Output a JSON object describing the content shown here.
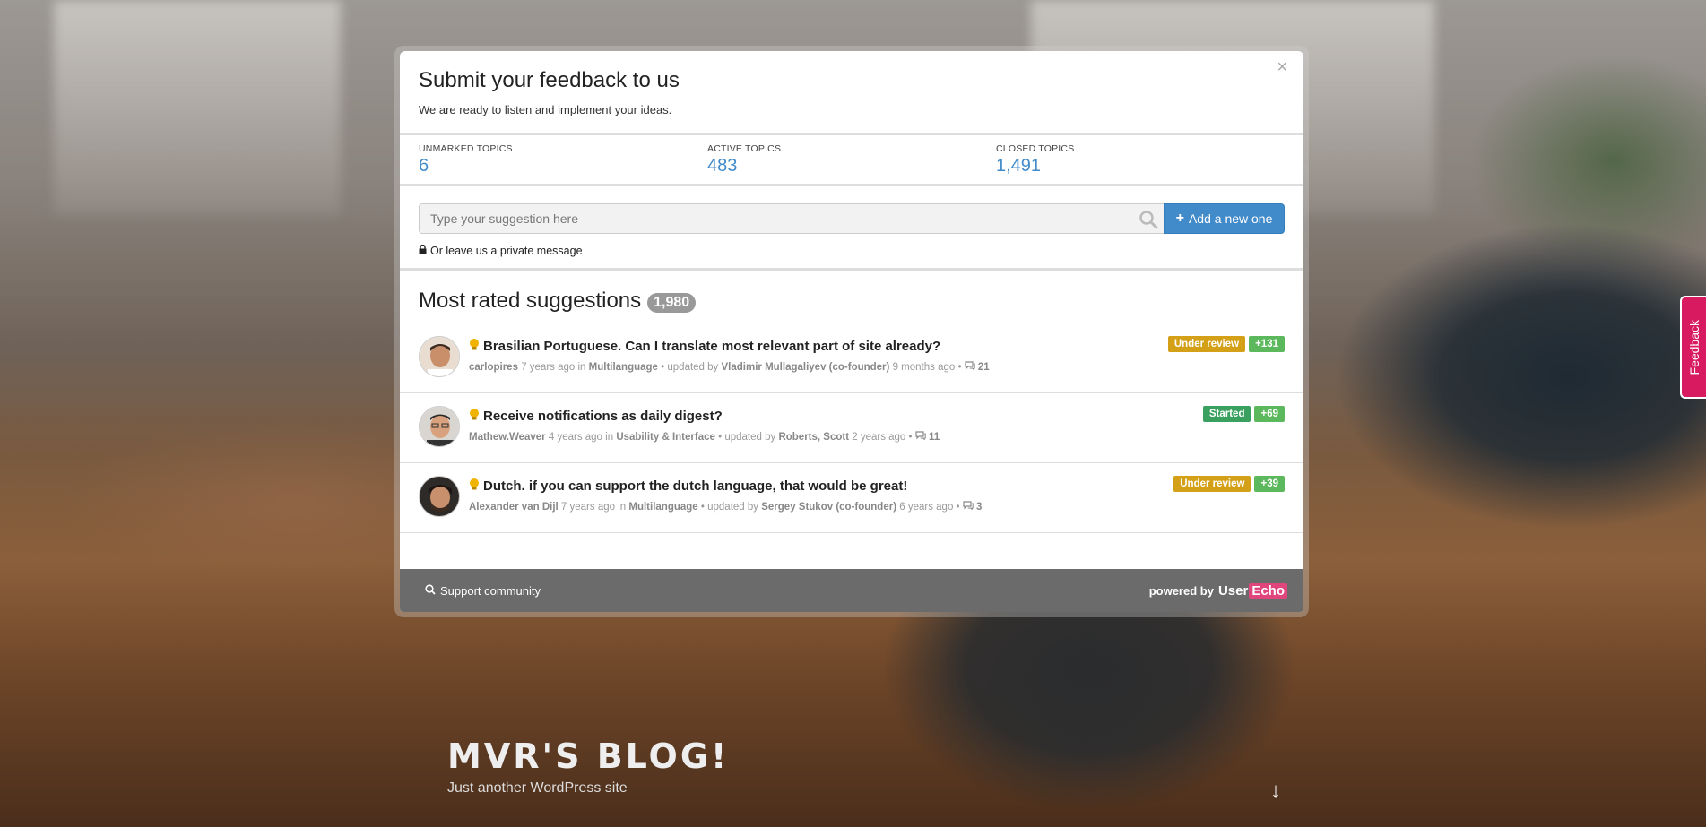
{
  "modal": {
    "title": "Submit your feedback to us",
    "subtitle": "We are ready to listen and implement your ideas.",
    "close_label": "×"
  },
  "stats": [
    {
      "label": "UNMARKED TOPICS",
      "value": "6"
    },
    {
      "label": "ACTIVE TOPICS",
      "value": "483"
    },
    {
      "label": "CLOSED TOPICS",
      "value": "1,491"
    }
  ],
  "search": {
    "placeholder": "Type your suggestion here",
    "add_button": "Add a new one",
    "private_message": "Or leave us a private message"
  },
  "section": {
    "title": "Most rated suggestions",
    "count": "1,980"
  },
  "topics": [
    {
      "title": "Brasilian Portuguese. Can I translate most relevant part of site already?",
      "status": "Under review",
      "votes": "+131",
      "author": "carlopires",
      "age": "7 years ago in",
      "category": "Multilanguage",
      "updated_prefix": "• updated by",
      "updated_by": "Vladimir Mullagaliyev (co-founder)",
      "updated_age": "9 months ago •",
      "comments": "21"
    },
    {
      "title": "Receive notifications as daily digest?",
      "status": "Started",
      "votes": "+69",
      "author": "Mathew.Weaver",
      "age": "4 years ago in",
      "category": "Usability & Interface",
      "updated_prefix": "• updated by",
      "updated_by": "Roberts, Scott",
      "updated_age": "2 years ago •",
      "comments": "11"
    },
    {
      "title": "Dutch. if you can support the dutch language, that would be great!",
      "status": "Under review",
      "votes": "+39",
      "author": "Alexander van Dijl",
      "age": "7 years ago in",
      "category": "Multilanguage",
      "updated_prefix": "• updated by",
      "updated_by": "Sergey Stukov (co-founder)",
      "updated_age": "6 years ago •",
      "comments": "3"
    }
  ],
  "footer": {
    "support_link": "Support community",
    "powered_by": "powered by",
    "logo_user": "User",
    "logo_echo": "Echo"
  },
  "feedback_tab": "Feedback",
  "blog": {
    "title": "MVR'S BLOG!",
    "tagline": "Just another WordPress site",
    "scroll_arrow": "↓"
  },
  "colors": {
    "accent": "#428bca",
    "under_review": "#d4a017",
    "started": "#3aa05f",
    "votes": "#5cb85c",
    "feedback_tab": "#d81b60"
  }
}
